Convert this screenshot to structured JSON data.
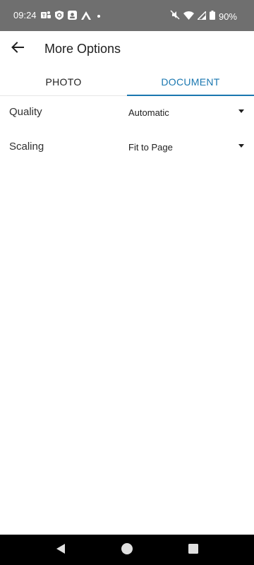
{
  "status_bar": {
    "time": "09:24",
    "battery": "90%",
    "left_icons": [
      "teams-icon",
      "shield-icon",
      "app-icon",
      "arrow-icon",
      "dot-icon"
    ],
    "right_icons": [
      "mute-icon",
      "wifi-icon",
      "signal-icon",
      "battery-icon"
    ]
  },
  "app_bar": {
    "title": "More Options",
    "back_icon": "back-arrow-icon"
  },
  "tabs": [
    {
      "label": "PHOTO",
      "selected": false
    },
    {
      "label": "DOCUMENT",
      "selected": true
    }
  ],
  "options": [
    {
      "label": "Quality",
      "value": "Automatic"
    },
    {
      "label": "Scaling",
      "value": "Fit to Page"
    }
  ],
  "colors": {
    "accent": "#1a77b0",
    "status_bar": "#6f6f6f",
    "nav_bar": "#000000"
  },
  "nav_bar": {
    "buttons": [
      "back-triangle-icon",
      "home-circle-icon",
      "recents-square-icon"
    ]
  }
}
